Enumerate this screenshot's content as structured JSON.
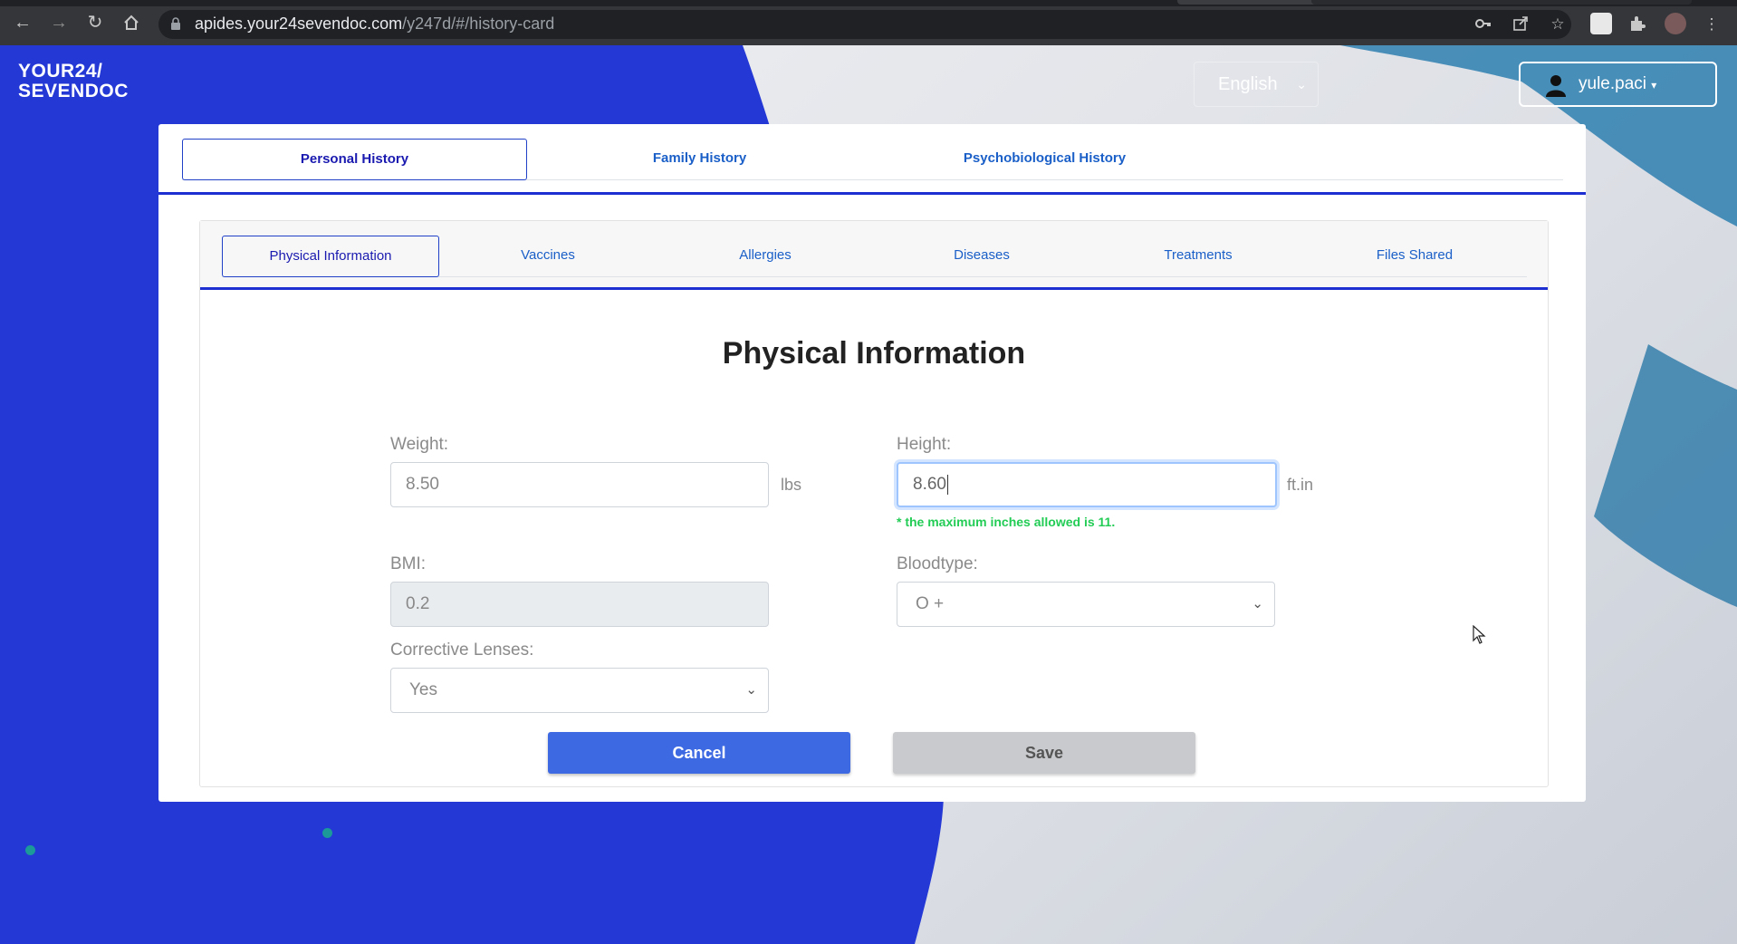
{
  "browser": {
    "url_host": "apides.your24sevendoc.com",
    "url_path": "/y247d/#/history-card"
  },
  "header": {
    "logo_line1": "YOUR24/",
    "logo_line2": "SEVENDOC",
    "language": "English",
    "username": "yule.paci"
  },
  "main_tabs": [
    {
      "label": "Personal History",
      "active": true
    },
    {
      "label": "Family History",
      "active": false
    },
    {
      "label": "Psychobiological History",
      "active": false
    }
  ],
  "sub_tabs": [
    {
      "label": "Physical Information",
      "active": true
    },
    {
      "label": "Vaccines",
      "active": false
    },
    {
      "label": "Allergies",
      "active": false
    },
    {
      "label": "Diseases",
      "active": false
    },
    {
      "label": "Treatments",
      "active": false
    },
    {
      "label": "Files Shared",
      "active": false
    }
  ],
  "form": {
    "title": "Physical Information",
    "weight": {
      "label": "Weight:",
      "value": "8.50",
      "unit": "lbs"
    },
    "height": {
      "label": "Height:",
      "value": "8.60",
      "unit": "ft.in",
      "hint": "* the maximum inches allowed is 11."
    },
    "bmi": {
      "label": "BMI:",
      "value": "0.2"
    },
    "bloodtype": {
      "label": "Bloodtype:",
      "value": "O +"
    },
    "lenses": {
      "label": "Corrective Lenses:",
      "value": "Yes"
    },
    "cancel_label": "Cancel",
    "save_label": "Save"
  },
  "colors": {
    "brand_blue": "#2438d6",
    "accent_blue": "#3d6ae3",
    "hint_green": "#22cc55"
  }
}
